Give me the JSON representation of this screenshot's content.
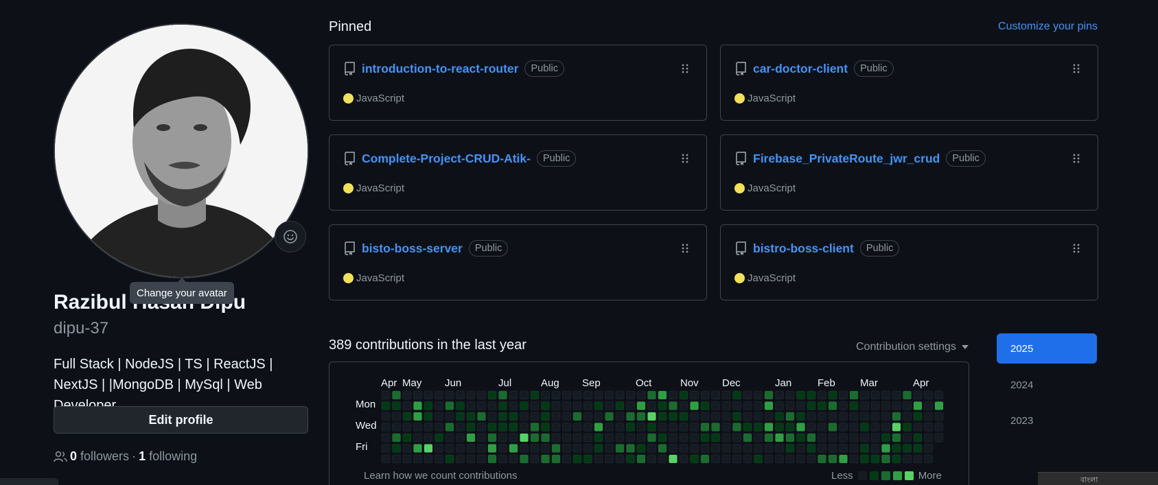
{
  "profile": {
    "name": "Razibul Hasan Dipu",
    "login": "dipu-37",
    "bio": "Full Stack | NodeJS | TS | ReactJS | NextJS | |MongoDB | MySql | Web Developer",
    "edit_label": "Edit profile",
    "followers_count": "0",
    "followers_label": "followers",
    "separator": "·",
    "following_count": "1",
    "following_label": "following",
    "tooltip": "Change your avatar"
  },
  "pinned": {
    "title": "Pinned",
    "customize_label": "Customize your pins",
    "items": [
      {
        "name": "introduction-to-react-router",
        "visibility": "Public",
        "language": "JavaScript",
        "language_color": "#f1e05a"
      },
      {
        "name": "car-doctor-client",
        "visibility": "Public",
        "language": "JavaScript",
        "language_color": "#f1e05a"
      },
      {
        "name": "Complete-Project-CRUD-Atik-",
        "visibility": "Public",
        "language": "JavaScript",
        "language_color": "#f1e05a"
      },
      {
        "name": "Firebase_PrivateRoute_jwr_crud",
        "visibility": "Public",
        "language": "JavaScript",
        "language_color": "#f1e05a"
      },
      {
        "name": "bisto-boss-server",
        "visibility": "Public",
        "language": "JavaScript",
        "language_color": "#f1e05a"
      },
      {
        "name": "bistro-boss-client",
        "visibility": "Public",
        "language": "JavaScript",
        "language_color": "#f1e05a"
      }
    ]
  },
  "contributions": {
    "title": "389 contributions in the last year",
    "settings_label": "Contribution settings",
    "months": [
      "Apr",
      "May",
      "Jun",
      "Jul",
      "Aug",
      "Sep",
      "Oct",
      "Nov",
      "Dec",
      "Jan",
      "Feb",
      "Mar",
      "Apr"
    ],
    "days": [
      "Mon",
      "Wed",
      "Fri"
    ],
    "learn_label": "Learn how we count contributions",
    "legend_less": "Less",
    "legend_more": "More",
    "level_colors": [
      "#151b23",
      "#033a16",
      "#196c2e",
      "#2ea043",
      "#56d364"
    ]
  },
  "years": [
    "2025",
    "2024",
    "2023"
  ],
  "corner_widget_text": "বাংলা"
}
